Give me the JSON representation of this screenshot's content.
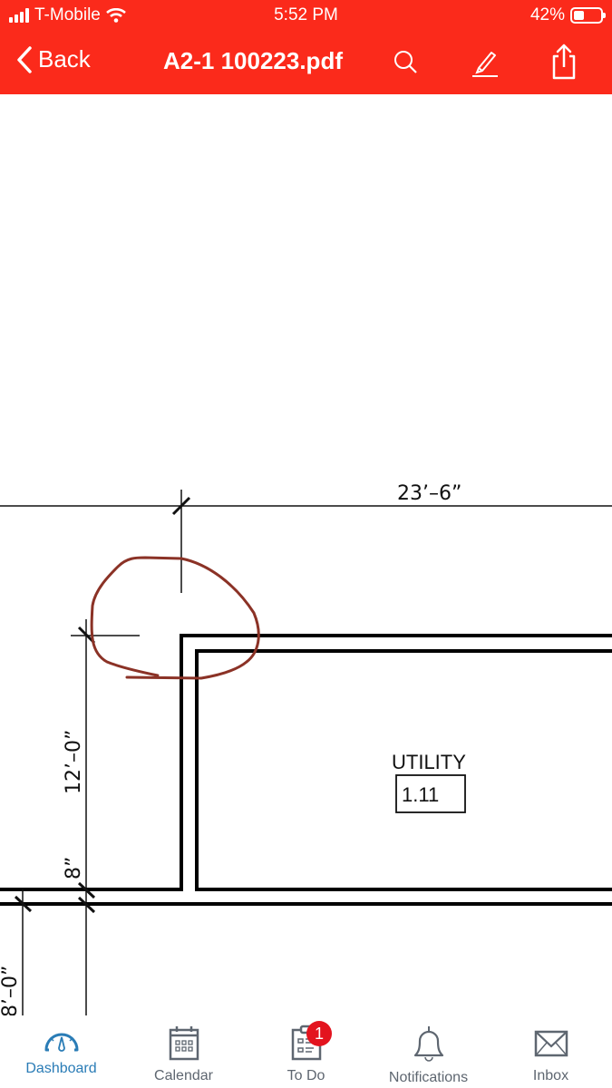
{
  "status_bar": {
    "carrier": "T-Mobile",
    "time": "5:52 PM",
    "battery": "42%",
    "battery_level": 0.42
  },
  "nav": {
    "back_label": "Back",
    "title": "A2-1 100223.pdf",
    "icons": [
      "search-icon",
      "markup-pen-icon",
      "share-icon"
    ]
  },
  "drawing": {
    "dimensions": {
      "top": "23’–6”",
      "left_vertical": "12’–0”",
      "wall": "8”",
      "bottom_left": "8’–0”"
    },
    "room": {
      "name": "UTILITY",
      "number": "1.11"
    },
    "annotation_color": "#8b3226"
  },
  "tabbar": {
    "tabs": [
      {
        "label": "Dashboard",
        "icon": "dashboard-gauge-icon",
        "active": true
      },
      {
        "label": "Calendar",
        "icon": "calendar-icon",
        "active": false
      },
      {
        "label": "To Do",
        "icon": "clipboard-icon",
        "active": false,
        "badge": "1"
      },
      {
        "label": "Notifications",
        "icon": "bell-icon",
        "active": false
      },
      {
        "label": "Inbox",
        "icon": "mail-icon",
        "active": false
      }
    ]
  },
  "colors": {
    "header": "#fb2a1b",
    "active_tab": "#2a7cb6",
    "inactive_tab": "#5e6670",
    "badge": "#e3141f"
  }
}
